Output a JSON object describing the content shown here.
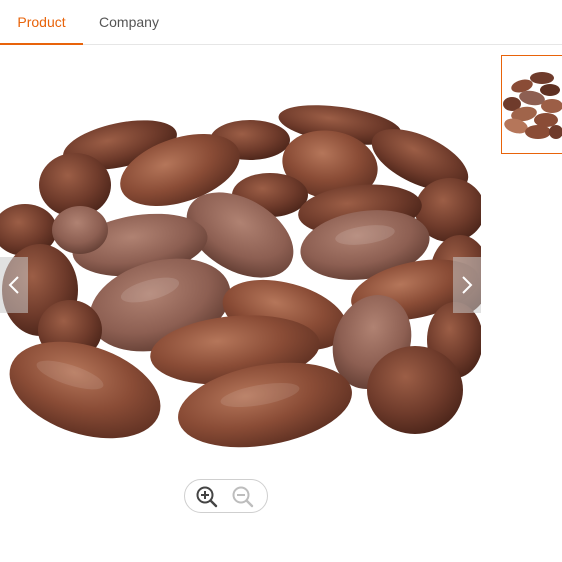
{
  "tabs": [
    {
      "label": "Product",
      "active": true
    },
    {
      "label": "Company",
      "active": false
    }
  ],
  "colors": {
    "accent": "#e8630a",
    "bean_dark": "#6b3a2a",
    "bean_mid": "#8a4c36",
    "bean_light": "#a0644a"
  },
  "gallery": {
    "main_image": "cocoa-beans-photo",
    "thumbnails": [
      "cocoa-beans-photo"
    ],
    "selected_thumbnail": 1
  },
  "icons": {
    "prev": "chevron-left-icon",
    "next": "chevron-right-icon",
    "zoom_in": "zoom-in-icon",
    "zoom_out": "zoom-out-icon"
  }
}
